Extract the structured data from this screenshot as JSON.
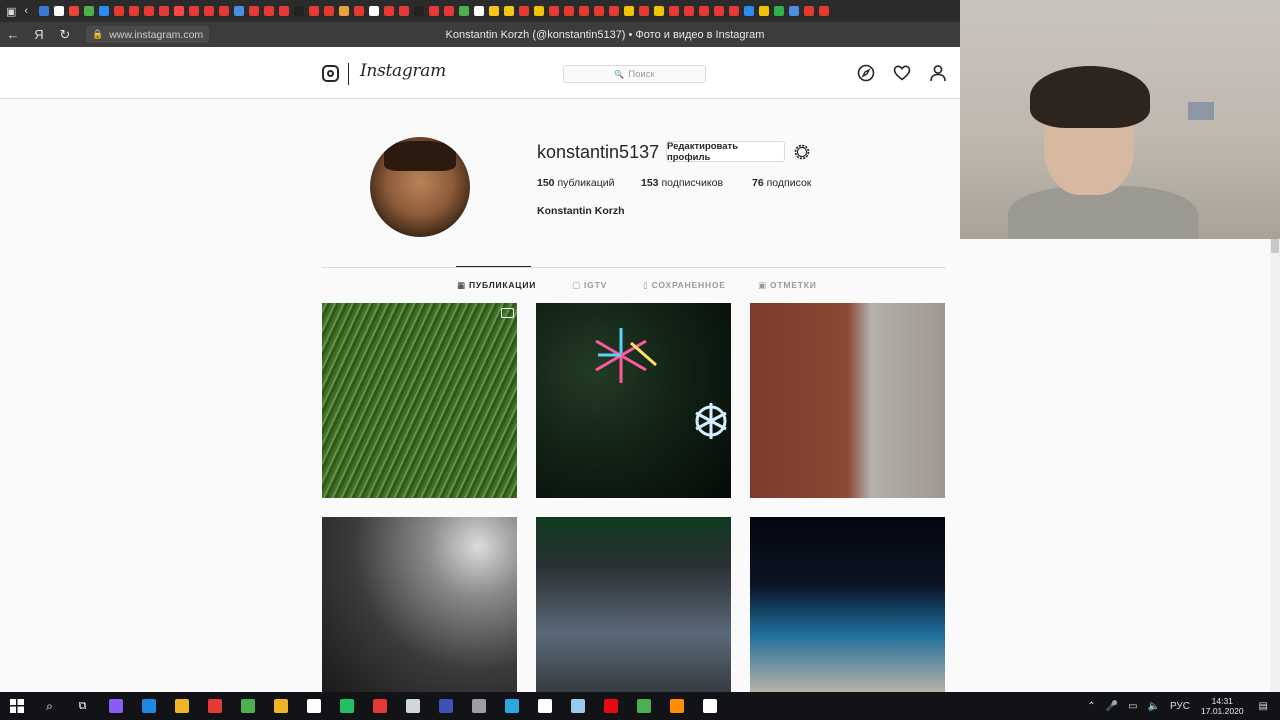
{
  "browser": {
    "url": "www.instagram.com",
    "page_title": "Konstantin Korzh (@konstantin5137) • Фото и видео в Instagram",
    "tab_favicons": [
      "#3a79d8",
      "#ffffff",
      "#e8443a",
      "#4caf50",
      "#2d8cf0",
      "#e53935",
      "#e53935",
      "#e53935",
      "#e53935",
      "#ff4444",
      "#e53935",
      "#e53935",
      "#e53935",
      "#4a90e2",
      "#e53935",
      "#e53935",
      "#e53935",
      "#222222",
      "#e53935",
      "#e53935",
      "#e8a33a",
      "#e53935",
      "#ffffff",
      "#e53935",
      "#e53935",
      "#222222",
      "#e53935",
      "#e53935",
      "#4caf50",
      "#ffffff",
      "#f5c518",
      "#f5c518",
      "#e53935",
      "#f0c400",
      "#e53935",
      "#e53935",
      "#e53935",
      "#e53935",
      "#e53935",
      "#f0c400",
      "#e53935",
      "#f0c400",
      "#e53935",
      "#e53935",
      "#e53935",
      "#e53935",
      "#e53935",
      "#2d8cf0",
      "#f0c400",
      "#2fb34a",
      "#4a90e2",
      "#e53935",
      "#e53935"
    ]
  },
  "instagram": {
    "logo_text": "Instagram",
    "search_placeholder": "Поиск",
    "username": "konstantin5137",
    "edit_profile_label": "Редактировать профиль",
    "stats": {
      "posts_count": "150",
      "posts_label": "публикаций",
      "followers_count": "153",
      "followers_label": "подписчиков",
      "following_count": "76",
      "following_label": "подписок"
    },
    "full_name": "Konstantin Korzh",
    "tabs": {
      "posts": "ПУБЛИКАЦИИ",
      "igtv": "IGTV",
      "saved": "СОХРАНЕННОЕ",
      "tagged": "ОТМЕТКИ"
    }
  },
  "taskbar": {
    "language": "РУС",
    "time": "14:31",
    "date": "17.01.2020",
    "app_colors": [
      "#8a5cf6",
      "#1e88e5",
      "#f0b429",
      "#e53935",
      "#4caf50",
      "#f0b429",
      "#ffffff",
      "#21c063",
      "#e53935",
      "#cfd8dc",
      "#3f51b5",
      "#9e9e9e",
      "#2ca5e0",
      "#ffffff",
      "#9ccaee",
      "#e50914",
      "#4caf50",
      "#ff8f00",
      "#ffffff"
    ]
  }
}
